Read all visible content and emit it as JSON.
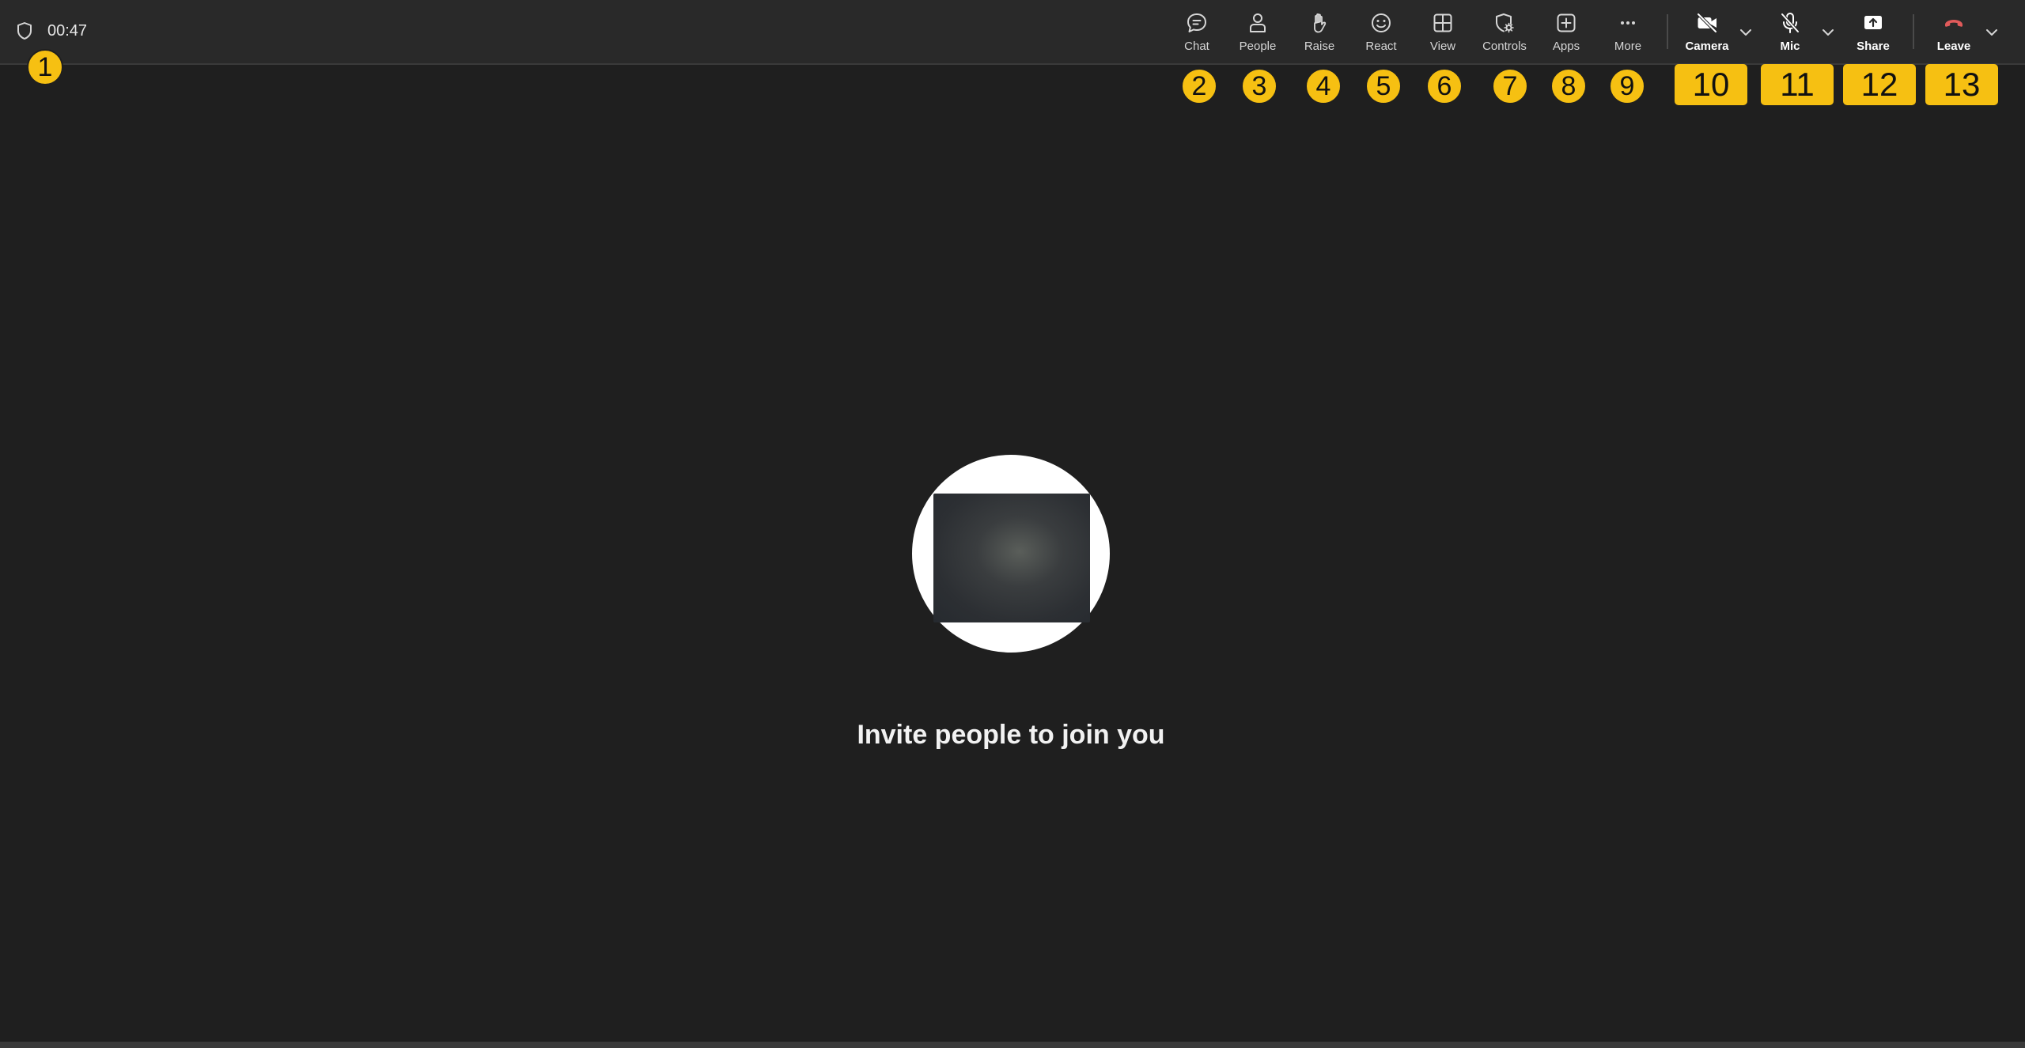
{
  "meeting": {
    "timer": "00:47"
  },
  "toolbar": {
    "chat": "Chat",
    "people": "People",
    "raise": "Raise",
    "react": "React",
    "view": "View",
    "controls": "Controls",
    "apps": "Apps",
    "more": "More",
    "camera": "Camera",
    "mic": "Mic",
    "share": "Share",
    "leave": "Leave"
  },
  "badges": [
    "1",
    "2",
    "3",
    "4",
    "5",
    "6",
    "7",
    "8",
    "9",
    "10",
    "11",
    "12",
    "13"
  ],
  "main": {
    "invite_text": "Invite people to join you"
  },
  "colors": {
    "background": "#1f1f1f",
    "topbar": "#292929",
    "badge": "#f6c012",
    "leave_red": "#e05a5a"
  }
}
